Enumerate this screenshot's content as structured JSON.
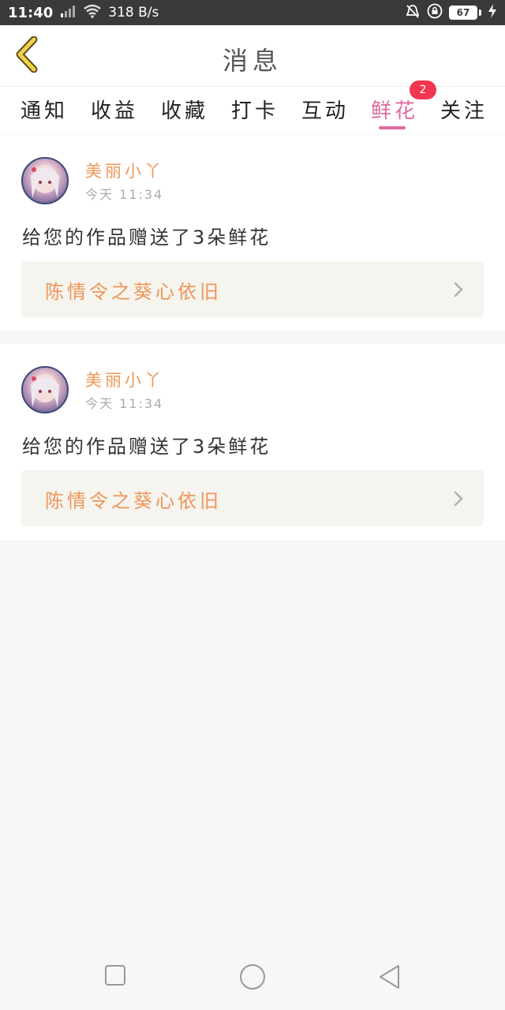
{
  "status_bar": {
    "time": "11:40",
    "network_speed": "318 B/s",
    "battery": "67",
    "icons": [
      "signal-icon",
      "wifi-icon",
      "alarm-off-icon",
      "lock-icon",
      "battery-icon",
      "charging-icon"
    ]
  },
  "header": {
    "title": "消息",
    "back_icon": "chevron-left-icon"
  },
  "tabs": [
    {
      "label": "通知"
    },
    {
      "label": "收益"
    },
    {
      "label": "收藏"
    },
    {
      "label": "打卡"
    },
    {
      "label": "互动"
    },
    {
      "label": "鲜花",
      "active": true,
      "badge": "2"
    },
    {
      "label": "关注"
    }
  ],
  "messages": [
    {
      "username": "美丽小丫",
      "time": "今天 11:34",
      "text": "给您的作品赠送了3朵鲜花",
      "work_title": "陈情令之葵心依旧"
    },
    {
      "username": "美丽小丫",
      "time": "今天 11:34",
      "text": "给您的作品赠送了3朵鲜花",
      "work_title": "陈情令之葵心依旧"
    }
  ],
  "colors": {
    "accent": "#e06aa0",
    "username": "#f0955a",
    "badge": "#f2364f",
    "back_icon": "#f3d24a"
  },
  "system_nav": [
    "recent-apps-icon",
    "home-icon",
    "back-triangle-icon"
  ]
}
